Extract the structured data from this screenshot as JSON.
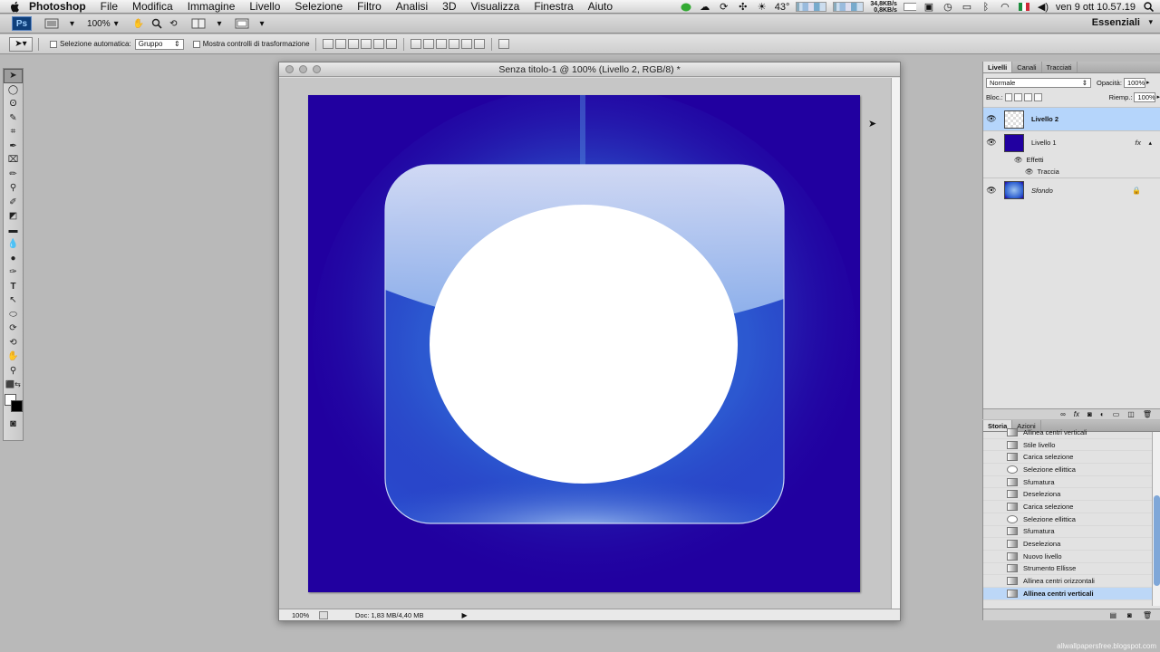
{
  "menubar": {
    "app": "Photoshop",
    "items": [
      "File",
      "Modifica",
      "Immagine",
      "Livello",
      "Selezione",
      "Filtro",
      "Analisi",
      "3D",
      "Visualizza",
      "Finestra",
      "Aiuto"
    ],
    "temperature": "43°",
    "net_up": "34,8KB/s",
    "net_down": "0,8KB/s",
    "clock": "ven 9 ott  10.57.19"
  },
  "appbar": {
    "zoom": "100%",
    "workspace": "Essenziali"
  },
  "options": {
    "auto_select_label": "Selezione automatica:",
    "auto_select_value": "Gruppo",
    "transform_label": "Mostra controlli di trasformazione"
  },
  "document": {
    "title": "Senza titolo-1 @ 100% (Livello 2, RGB/8) *",
    "status_zoom": "100%",
    "status_info": "Doc: 1,83 MB/4,40 MB",
    "colors": {
      "canvas": "#2100a0",
      "shape": "#ffffff"
    }
  },
  "layers_panel": {
    "tabs": [
      "Livelli",
      "Canali",
      "Tracciati"
    ],
    "blend_mode": "Normale",
    "opacity_label": "Opacità:",
    "opacity_value": "100%",
    "lock_label": "Bloc.:",
    "fill_label": "Riemp.:",
    "fill_value": "100%",
    "layers": [
      {
        "name": "Livello 2"
      },
      {
        "name": "Livello 1",
        "fx": "fx"
      },
      {
        "name": "Sfondo"
      }
    ],
    "effects_label": "Effetti",
    "effect_item": "Traccia"
  },
  "history_panel": {
    "tabs": [
      "Storia",
      "Azioni"
    ],
    "items": [
      "Allinea centri verticali",
      "Stile livello",
      "Carica selezione",
      "Selezione ellittica",
      "Sfumatura",
      "Deseleziona",
      "Carica selezione",
      "Selezione ellittica",
      "Sfumatura",
      "Deseleziona",
      "Nuovo livello",
      "Strumento Ellisse",
      "Allinea centri orizzontali",
      "Allinea centri verticali"
    ]
  },
  "watermark": "allwallpapersfree.blogspot.com"
}
